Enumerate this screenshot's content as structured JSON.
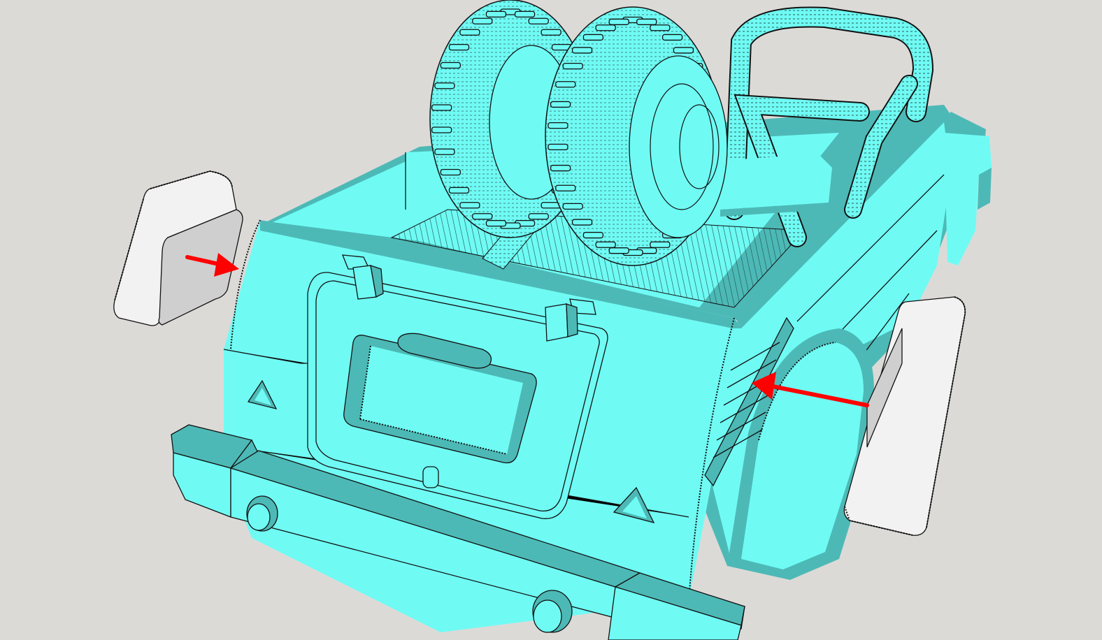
{
  "viewport": {
    "background_color": "#dcdad7"
  },
  "model": {
    "body_color": "#6ffbf4",
    "body_shadow_color": "#4db9b6",
    "body_dark_color": "#3fa5a2",
    "edge_color": "#111111",
    "detached_part_color": "#cfcfcf",
    "detached_part_light": "#f2f2f2"
  },
  "annotations": {
    "arrow_color": "#ff0000",
    "arrows": [
      {
        "icon": "arrow-right-icon",
        "points_to": "rear-left-corner"
      },
      {
        "icon": "arrow-left-icon",
        "points_to": "side-vent-slats"
      }
    ]
  }
}
